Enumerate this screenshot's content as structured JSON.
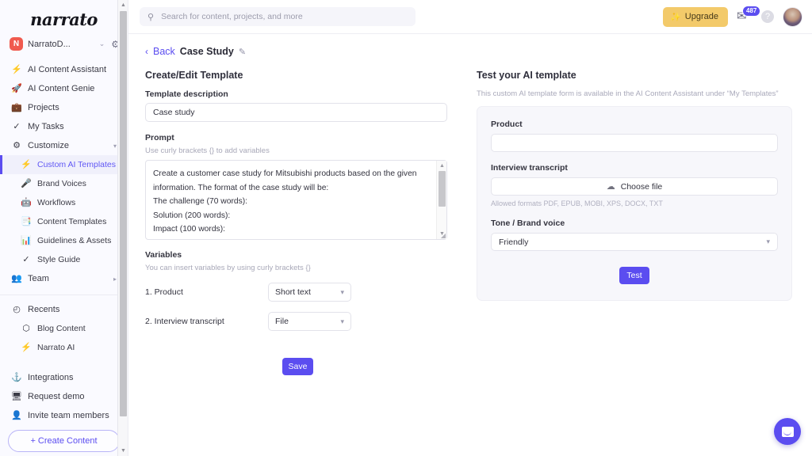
{
  "sidebar": {
    "logo": "narrato",
    "workspace": {
      "initial": "N",
      "name": "NarratoD...",
      "chevron": "⌄",
      "gear": "⚙"
    },
    "nav": [
      {
        "icon": "⚡",
        "label": "AI Content Assistant"
      },
      {
        "icon": "🚀",
        "label": "AI Content Genie"
      },
      {
        "icon": "💼",
        "label": "Projects"
      },
      {
        "icon": "✓",
        "label": "My Tasks"
      },
      {
        "icon": "⚙",
        "label": "Customize",
        "chevron": "▾"
      }
    ],
    "sub_nav": [
      {
        "icon": "⚡",
        "label": "Custom AI Templates",
        "active": true
      },
      {
        "icon": "🎤",
        "label": "Brand Voices"
      },
      {
        "icon": "🤖",
        "label": "Workflows"
      },
      {
        "icon": "📑",
        "label": "Content Templates"
      },
      {
        "icon": "📊",
        "label": "Guidelines & Assets"
      },
      {
        "icon": "✓",
        "label": "Style Guide"
      }
    ],
    "team": {
      "icon": "👥",
      "label": "Team",
      "chevron": "▸"
    },
    "recents": {
      "icon": "◴",
      "label": "Recents",
      "items": [
        {
          "icon": "⬡",
          "label": "Blog Content"
        },
        {
          "icon": "⚡",
          "label": "Narrato AI"
        }
      ]
    },
    "bottom": [
      {
        "icon": "⚓",
        "label": "Integrations"
      },
      {
        "icon": "🖥",
        "label": "Request demo"
      },
      {
        "icon": "👤",
        "label": "Invite team members"
      }
    ],
    "create_button": "+ Create Content"
  },
  "topbar": {
    "search_placeholder": "Search for content, projects, and more",
    "search_value": "",
    "search_icon": "⚲",
    "upgrade_label": "Upgrade",
    "upgrade_icon": "✨",
    "mail_icon": "✉",
    "mail_badge": "487",
    "help_icon": "?"
  },
  "breadcrumb": {
    "chevron": "‹",
    "back": "Back",
    "title": "Case Study",
    "edit_icon": "✎"
  },
  "left": {
    "section_title": "Create/Edit Template",
    "description_label": "Template description",
    "description_value": "Case study",
    "description_placeholder": "",
    "prompt_label": "Prompt",
    "prompt_hint": "Use curly brackets {} to add variables",
    "prompt_value": "Create a customer case study for Mitsubishi products based on the given information. The format of the case study will be:\nThe challenge (70 words):\nSolution (200 words):\nImpact (100 words):",
    "variables_label": "Variables",
    "variables_hint": "You can insert variables by using curly brackets {}",
    "variables": [
      {
        "name": "1. Product",
        "type": "Short text"
      },
      {
        "name": "2. Interview transcript",
        "type": "File"
      }
    ],
    "save_label": "Save"
  },
  "right": {
    "section_title": "Test your AI template",
    "subtitle": "This custom AI template form is available in the AI Content Assistant under “My Templates”",
    "product_label": "Product",
    "product_value": "",
    "transcript_label": "Interview transcript",
    "choose_file_label": "Choose file",
    "choose_file_icon": "☁",
    "allowed_formats": "Allowed formats PDF, EPUB, MOBI, XPS, DOCX, TXT",
    "tone_label": "Tone / Brand voice",
    "tone_value": "Friendly",
    "test_label": "Test"
  },
  "chat": {
    "icon": "chat-bubble-icon"
  },
  "colors": {
    "accent": "#5b4df0",
    "upgrade": "#f3ca6a",
    "workspace_badge": "#f05a4f",
    "sidebar_bg": "#fafaff",
    "card_bg": "#f7f7fb"
  }
}
